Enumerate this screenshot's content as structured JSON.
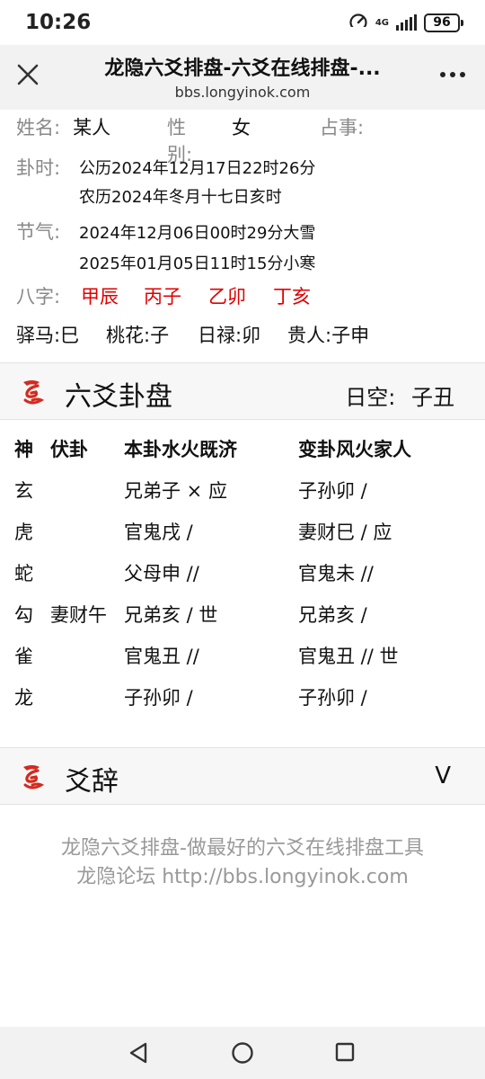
{
  "status": {
    "time": "10:26",
    "network": "4G",
    "battery": "96"
  },
  "titlebar": {
    "title": "龙隐六爻排盘-六爻在线排盘-...",
    "url": "bbs.longyinok.com"
  },
  "info": {
    "name_label": "姓名:",
    "name_value": "某人",
    "gender_label": "性别:",
    "gender_value": "女",
    "matter_label": "占事:",
    "time_label": "卦时:",
    "solar": "公历2024年12月17日22时26分",
    "lunar": "农历2024年冬月十七日亥时",
    "term_label": "节气:",
    "term1": "2024年12月06日00时29分大雪",
    "term2": "2025年01月05日11时15分小寒",
    "bazi_label": "八字:",
    "bazi": [
      "甲辰",
      "丙子",
      "乙卯",
      "丁亥"
    ],
    "extras": [
      "驿马:巳",
      "桃花:子",
      "日禄:卯",
      "贵人:子申"
    ]
  },
  "hexagram_section": {
    "title": "六爻卦盘",
    "empty_label": "日空:",
    "empty_value": "子丑"
  },
  "table": {
    "headers": {
      "god": "神",
      "fu": "伏卦",
      "ben": "本卦水火既济",
      "bian": "变卦风火家人"
    },
    "rows": [
      {
        "god": "玄",
        "fu": "",
        "ben": "兄弟子 × 应",
        "bian": "子孙卯  /"
      },
      {
        "god": "虎",
        "fu": "",
        "ben": "官鬼戌  /",
        "bian": "妻财巳  /  应"
      },
      {
        "god": "蛇",
        "fu": "",
        "ben": "父母申 //",
        "bian": "官鬼未 //"
      },
      {
        "god": "勾",
        "fu": "妻财午",
        "ben": "兄弟亥  /  世",
        "bian": "兄弟亥  /"
      },
      {
        "god": "雀",
        "fu": "",
        "ben": "官鬼丑 //",
        "bian": "官鬼丑 // 世"
      },
      {
        "god": "龙",
        "fu": "",
        "ben": "子孙卯  /",
        "bian": "子孙卯  /"
      }
    ]
  },
  "yaoci_section": {
    "title": "爻辞",
    "toggle": "V"
  },
  "footer": {
    "line1": "龙隐六爻排盘-做最好的六爻在线排盘工具",
    "line2": "龙隐论坛 http://bbs.longyinok.com"
  },
  "colors": {
    "accent_red": "#e00000",
    "label_gray": "#888888"
  }
}
